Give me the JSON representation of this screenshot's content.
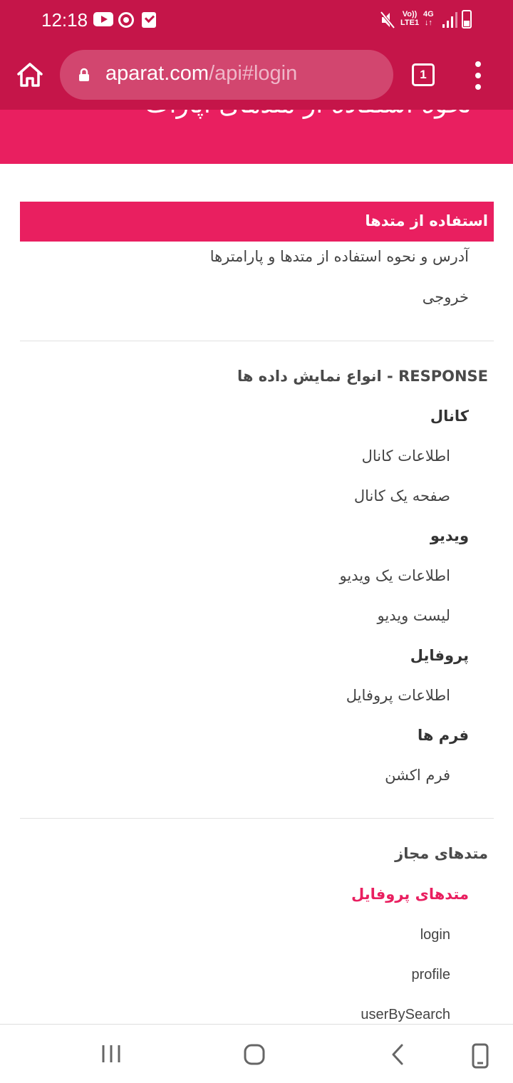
{
  "status_bar": {
    "time": "12:18",
    "icons": [
      "youtube-icon",
      "sync-icon",
      "checklist-icon",
      "mute-icon",
      "volte-icon",
      "network-4g-icon",
      "signal-icon",
      "battery-icon"
    ],
    "volte_top": "Vo))",
    "volte_bottom": "LTE1",
    "network_top": "4G",
    "network_bottom": "↓↑",
    "background": "#c51549"
  },
  "browser": {
    "url_domain": "aparat.com",
    "url_path": "/api#login",
    "tab_count": "1",
    "toolbar_color": "#c51549"
  },
  "page": {
    "hero_title": "نحوه استفاده از متدهای آپارات",
    "accent": "#e91f60",
    "nav_header": "استفاده از متدها",
    "usage_items": [
      "آدرس و نحوه استفاده از متدها و پارامترها",
      "خروجی"
    ],
    "response_section": {
      "title": "RESPONSE - انواع نمایش داده ها",
      "groups": [
        {
          "label": "کانال",
          "items": [
            "اطلاعات کانال",
            "صفحه یک کانال"
          ]
        },
        {
          "label": "ویدیو",
          "items": [
            "اطلاعات یک ویدیو",
            "لیست ویدیو"
          ]
        },
        {
          "label": "پروفایل",
          "items": [
            "اطلاعات پروفایل"
          ]
        },
        {
          "label": "فرم ها",
          "items": [
            "فرم اکشن"
          ]
        }
      ]
    },
    "methods_section": {
      "title": "متدهای مجاز",
      "active_group": "متدهای پروفایل",
      "items": [
        "login",
        "profile",
        "userBySearch"
      ]
    }
  },
  "bottom_nav": {
    "icons": [
      "recent-apps-icon",
      "home-icon",
      "back-icon",
      "screen-rotate-icon"
    ]
  }
}
